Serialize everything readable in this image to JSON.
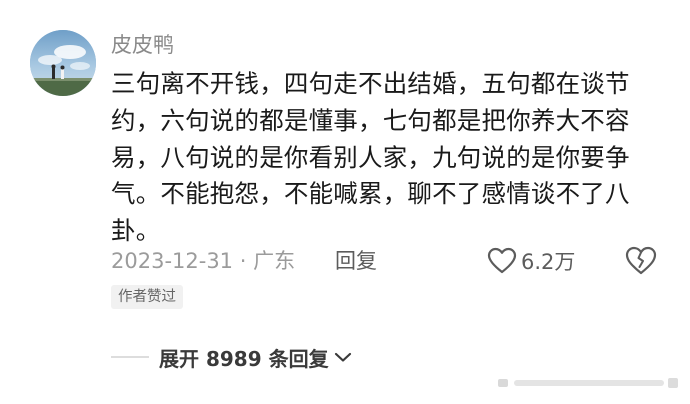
{
  "comment": {
    "username": "皮皮鸭",
    "avatar_icon": "avatar-photo-sky-icon",
    "text": "三句离不开钱，四句走不出结婚，五句都在谈节约，六句说的都是懂事，七句都是把你养大不容易，八句说的是你看别人家，九句说的是你要争气。不能抱怨，不能喊累，聊不了感情谈不了八卦。",
    "date_location": "2023-12-31 · 广东",
    "reply_label": "回复",
    "like_count": "6.2万",
    "like_icon": "heart-outline-icon",
    "dislike_icon": "broken-heart-icon",
    "author_badge": "作者赞过",
    "expand_label": "展开 8989 条回复",
    "expand_icon": "chevron-down-icon",
    "watermark_icon": "blurred-watermark-icon"
  },
  "colors": {
    "username": "#8a8a8a",
    "body_text": "#1a1a1a",
    "meta": "#9b9b9b",
    "action": "#5c5c5c",
    "badge_bg": "#f1f1f1",
    "divider": "#dddddd"
  }
}
